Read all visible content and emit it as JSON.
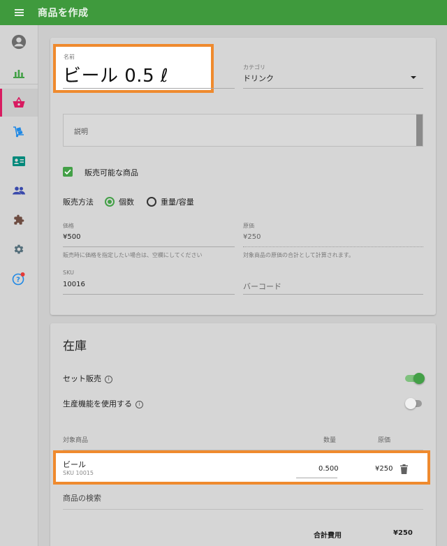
{
  "app": {
    "title": "商品を作成"
  },
  "colors": {
    "appbar": "#3f9a3d",
    "accent": "#43a047",
    "active_marker": "#d81b60",
    "highlight": "#ef8a2e"
  },
  "sidebar": {
    "items": [
      {
        "icon": "account-circle-icon"
      },
      {
        "icon": "bar-chart-icon"
      },
      {
        "icon": "shopping-basket-icon",
        "active": true
      },
      {
        "icon": "hand-truck-icon"
      },
      {
        "icon": "contact-card-icon"
      },
      {
        "icon": "people-icon"
      },
      {
        "icon": "puzzle-icon"
      },
      {
        "icon": "gear-icon"
      },
      {
        "icon": "help-icon"
      }
    ]
  },
  "form": {
    "name": {
      "label": "名前",
      "value": "ビール 0.5 ℓ"
    },
    "category": {
      "label": "カテゴリ",
      "value": "ドリンク"
    },
    "description": {
      "placeholder": "説明"
    },
    "saleable": {
      "label": "販売可能な商品",
      "checked": true
    },
    "sales_method": {
      "label": "販売方法",
      "option_count": "個数",
      "option_weight": "重量/容量",
      "selected": "個数"
    },
    "price": {
      "label": "価格",
      "value": "¥500",
      "hint": "販売時に価格を指定したい場合は、空欄にしてください"
    },
    "cost": {
      "label": "原価",
      "value": "¥250",
      "hint": "対象商品の原価の合計として計算されます。"
    },
    "sku": {
      "label": "SKU",
      "value": "10016"
    },
    "barcode": {
      "placeholder": "バーコード"
    }
  },
  "inventory": {
    "title": "在庫",
    "set_sale": {
      "label": "セット販売",
      "on": true
    },
    "production": {
      "label": "生産機能を使用する",
      "on": false
    },
    "columns": {
      "item": "対象商品",
      "qty": "数量",
      "cost": "原価"
    },
    "rows": [
      {
        "name": "ビール",
        "sku": "SKU 10015",
        "qty": "0.500",
        "cost": "¥250"
      }
    ],
    "search_placeholder": "商品の検索",
    "total_label": "合計費用",
    "total_value": "¥250"
  }
}
